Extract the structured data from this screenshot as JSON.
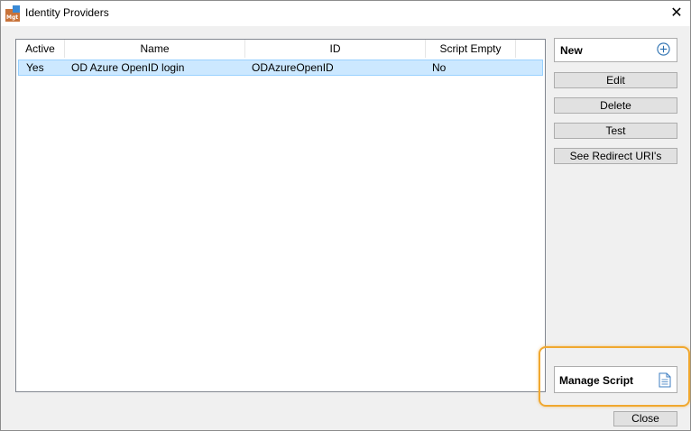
{
  "window": {
    "title": "Identity Providers",
    "icon": "app-icon",
    "close_glyph": "✕"
  },
  "table": {
    "columns": [
      "Active",
      "Name",
      "ID",
      "Script Empty"
    ],
    "rows": [
      {
        "active": "Yes",
        "name": "OD Azure OpenID login",
        "id": "ODAzureOpenID",
        "script_empty": "No",
        "selected": true
      }
    ]
  },
  "actions": {
    "new_label": "New",
    "edit_label": "Edit",
    "delete_label": "Delete",
    "test_label": "Test",
    "redirect_label": "See Redirect URI's",
    "manage_script_label": "Manage Script",
    "close_label": "Close"
  },
  "colors": {
    "selection": "#cce8ff",
    "highlight": "#f0a830",
    "accent_icon": "#2a6fb0"
  }
}
